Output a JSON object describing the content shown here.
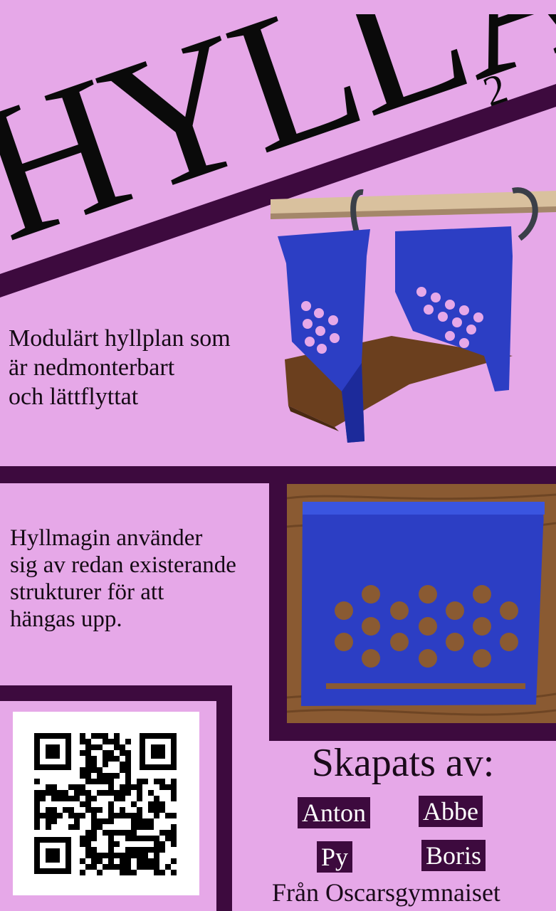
{
  "poster": {
    "title": "HYLLA",
    "title_superscript": "2",
    "tagline_lines": [
      "Modulärt hyllplan som",
      "är nedmonterbart",
      "och lättflyttat"
    ],
    "description_lines": [
      "Hyllmagin använder",
      "sig av redan existerande",
      "strukturer för att",
      "hängas upp."
    ],
    "credits_title": "Skapats av:",
    "names": [
      "Anton",
      "Abbe",
      "Py",
      "Boris"
    ],
    "from_line": "Från Oscarsgymnaiset"
  },
  "colors": {
    "background": "#e6a8e8",
    "band": "#3d0a3e",
    "product_blue": "#2c3ec4",
    "wood": "#6b3f1e"
  },
  "icons": {
    "qr": "qr-code-icon"
  }
}
